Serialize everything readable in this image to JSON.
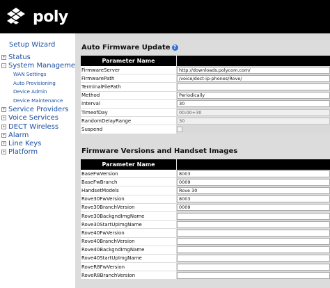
{
  "brand": {
    "name": "poly"
  },
  "sidebar": {
    "wizard": "Setup Wizard",
    "items": [
      {
        "label": "Status",
        "expander": "+"
      },
      {
        "label": "System Management",
        "expander": "-"
      },
      {
        "label": "WAN Settings",
        "sub": true
      },
      {
        "label": "Auto Provisioning",
        "sub": true
      },
      {
        "label": "Device Admin",
        "sub": true
      },
      {
        "label": "Device Maintenance",
        "sub": true
      },
      {
        "label": "Service Providers",
        "expander": "+"
      },
      {
        "label": "Voice Services",
        "expander": "+"
      },
      {
        "label": "DECT Wireless",
        "expander": "+"
      },
      {
        "label": "Alarm",
        "expander": "+"
      },
      {
        "label": "Line Keys",
        "expander": "+"
      },
      {
        "label": "Platform",
        "expander": "+"
      }
    ]
  },
  "auto_update": {
    "title": "Auto Firmware Update",
    "help_glyph": "?",
    "header": "Parameter Name",
    "rows": [
      {
        "label": "FirmwareServer",
        "value": "http://downloads.polycom.com/",
        "kind": "text"
      },
      {
        "label": "FirmwarePath",
        "value": "/voice/dect-ip-phones/Rove/",
        "kind": "text"
      },
      {
        "label": "TerminalFilePath",
        "value": "",
        "kind": "text"
      },
      {
        "label": "Method",
        "value": "Periodically",
        "kind": "select"
      },
      {
        "label": "Interval",
        "value": "30",
        "kind": "text"
      },
      {
        "label": "TimeofDay",
        "value": "00:00+30",
        "kind": "ro"
      },
      {
        "label": "RandomDelayRange",
        "value": "30",
        "kind": "ro"
      },
      {
        "label": "Suspend",
        "value": "",
        "kind": "checkbox"
      }
    ]
  },
  "firmware_versions": {
    "title": "Firmware Versions and Handset Images",
    "header": "Parameter Name",
    "rows": [
      {
        "label": "BaseFwVersion",
        "value": "8003"
      },
      {
        "label": "BaseFwBranch",
        "value": "0009"
      },
      {
        "label": "HandsetModels",
        "value": "Rove 30"
      },
      {
        "label": "Rove30FwVersion",
        "value": "8003"
      },
      {
        "label": "Rove30BranchVersion",
        "value": "0009"
      },
      {
        "label": "Rove30BackgndImgName",
        "value": ""
      },
      {
        "label": "Rove30StartUpImgName",
        "value": ""
      },
      {
        "label": "Rove40FwVersion",
        "value": ""
      },
      {
        "label": "Rove40BranchVersion",
        "value": ""
      },
      {
        "label": "Rove40BackgndImgName",
        "value": ""
      },
      {
        "label": "Rove40StartUpImgName",
        "value": ""
      },
      {
        "label": "RoveR8FwVersion",
        "value": ""
      },
      {
        "label": "RoveR8BranchVersion",
        "value": ""
      }
    ]
  }
}
